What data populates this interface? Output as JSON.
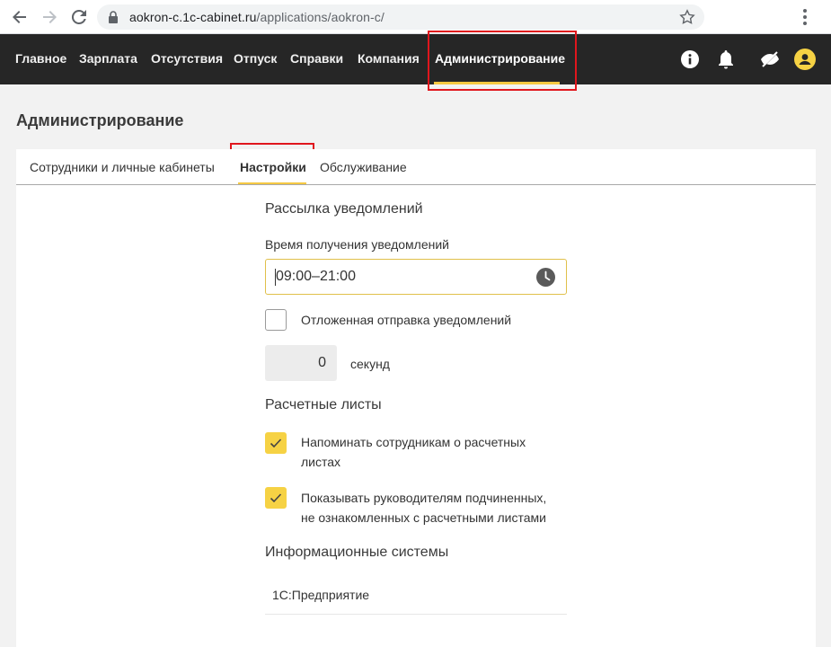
{
  "browser": {
    "url_host": "aokron-c.1c-cabinet.ru",
    "url_path": "/applications/aokron-c/"
  },
  "topnav": {
    "items": [
      "Главное",
      "Зарплата",
      "Отсутствия",
      "Отпуск",
      "Справки",
      "Компания",
      "Администрирование"
    ],
    "active": "Администрирование",
    "accent_color": "#f5c842"
  },
  "page": {
    "title": "Администрирование"
  },
  "tabs": {
    "items": [
      "Сотрудники и личные кабинеты",
      "Настройки",
      "Обслуживание"
    ],
    "active": "Настройки"
  },
  "notifications": {
    "title": "Рассылка уведомлений",
    "time_label": "Время получения уведомлений",
    "time_value": "09:00–21:00",
    "delayed_label": "Отложенная отправка уведомлений",
    "delayed_checked": false,
    "delay_value": "0",
    "delay_unit": "секунд"
  },
  "payslips": {
    "title": "Расчетные листы",
    "remind_line1": "Напоминать сотрудникам о расчетных",
    "remind_line2": "листах",
    "remind_checked": true,
    "managers_line1": "Показывать руководителям подчиненных,",
    "managers_line2": "не ознакомленных с расчетными листами",
    "managers_checked": true
  },
  "info_systems": {
    "title": "Информационные системы",
    "items": [
      "1С:Предприятие"
    ]
  },
  "icons": [
    "back-arrow-icon",
    "forward-arrow-icon",
    "reload-icon",
    "lock-icon",
    "star-icon",
    "kebab-menu-icon",
    "info-icon",
    "bell-icon",
    "eye-slash-icon",
    "user-avatar-icon",
    "clock-icon",
    "checkmark-icon"
  ]
}
